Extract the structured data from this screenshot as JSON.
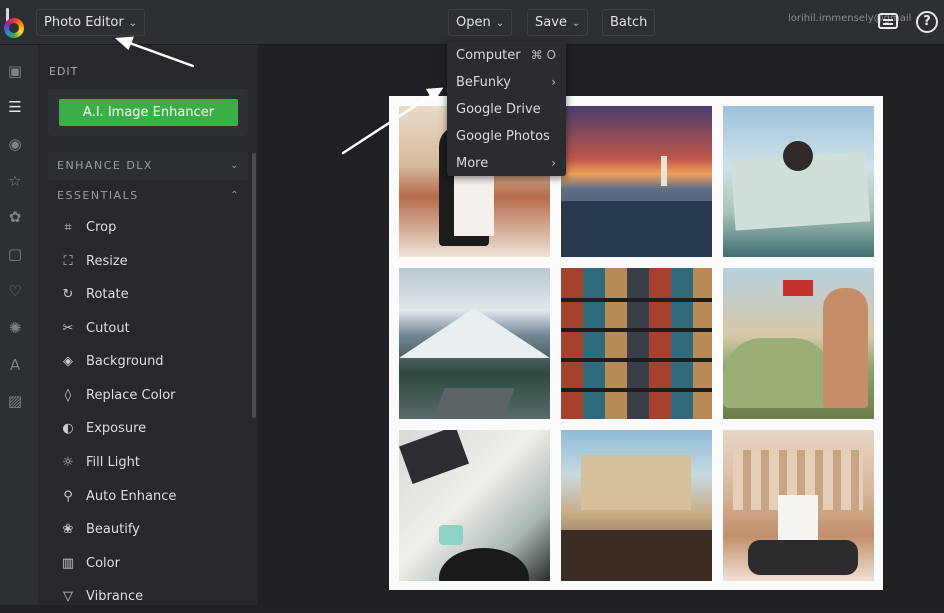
{
  "header": {
    "app_menu_label": "Photo Editor",
    "open_label": "Open",
    "save_label": "Save",
    "batch_label": "Batch",
    "account_text": "lorihil.immensely@gmail",
    "help_icon": "help-icon",
    "chat_icon": "chat-icon"
  },
  "rail": {
    "items": [
      "image-icon",
      "sliders-icon",
      "eye-icon",
      "star-icon",
      "effects-icon",
      "frame-icon",
      "heart-icon",
      "badge-icon",
      "text-icon",
      "texture-icon"
    ]
  },
  "panel": {
    "edit_label": "EDIT",
    "ai_button_label": "A.I. Image Enhancer",
    "enhance_dlx_label": "ENHANCE DLX",
    "essentials_label": "ESSENTIALS",
    "tools": [
      {
        "label": "Crop",
        "icon": "crop-icon"
      },
      {
        "label": "Resize",
        "icon": "resize-icon"
      },
      {
        "label": "Rotate",
        "icon": "rotate-icon"
      },
      {
        "label": "Cutout",
        "icon": "scissors-icon"
      },
      {
        "label": "Background",
        "icon": "background-icon"
      },
      {
        "label": "Replace Color",
        "icon": "drop-icon"
      },
      {
        "label": "Exposure",
        "icon": "exposure-icon"
      },
      {
        "label": "Fill Light",
        "icon": "sun-icon"
      },
      {
        "label": "Auto Enhance",
        "icon": "wand-icon"
      },
      {
        "label": "Beautify",
        "icon": "flower-icon"
      },
      {
        "label": "Color",
        "icon": "color-icon"
      },
      {
        "label": "Vibrance",
        "icon": "vibrance-icon"
      }
    ]
  },
  "open_menu": {
    "items": [
      {
        "label": "Computer",
        "shortcut": "⌘ O"
      },
      {
        "label": "BeFunky",
        "shortcut": "›"
      },
      {
        "label": "Google Drive",
        "shortcut": ""
      },
      {
        "label": "Google Photos",
        "shortcut": ""
      },
      {
        "label": "More",
        "shortcut": "›"
      }
    ]
  },
  "colors": {
    "accent_green": "#3cae48",
    "topbar": "#2c2f33",
    "panel": "#26282c"
  }
}
